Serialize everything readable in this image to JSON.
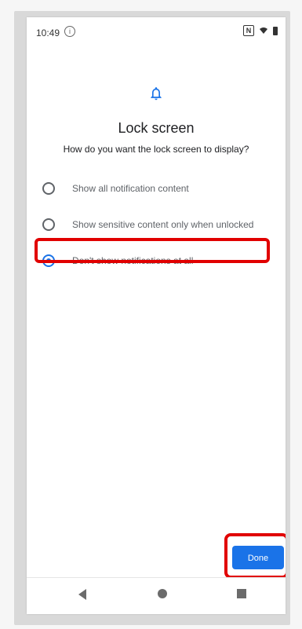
{
  "status": {
    "time": "10:49",
    "info_icon": "i",
    "nfc_icon": "N"
  },
  "header": {
    "icon": "bell-icon",
    "title": "Lock screen",
    "subtitle": "How do you want the lock screen to display?"
  },
  "options": [
    {
      "label": "Show all notification content",
      "selected": false
    },
    {
      "label": "Show sensitive content only when unlocked",
      "selected": false
    },
    {
      "label": "Don't show notifications at all",
      "selected": true
    }
  ],
  "actions": {
    "done_label": "Done"
  },
  "colors": {
    "accent": "#1a73e8",
    "highlight": "#e10000"
  },
  "navigation": {
    "back_icon": "back-icon",
    "home_icon": "home-icon",
    "recent_icon": "recent-apps-icon"
  }
}
